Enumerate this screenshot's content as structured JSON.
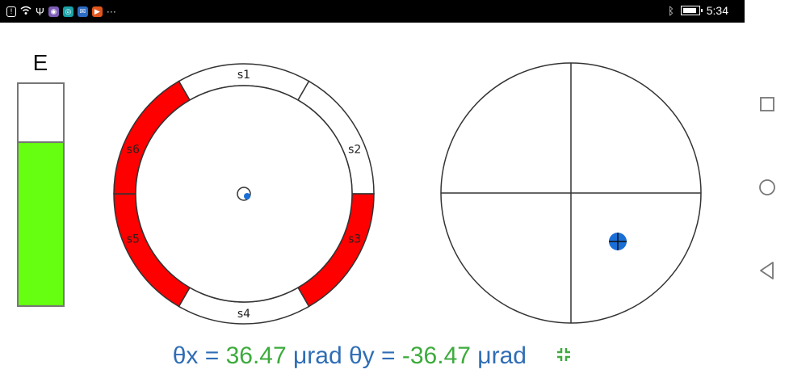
{
  "status_bar": {
    "time": "5:34",
    "notification_icons": [
      "alert-icon",
      "wifi-icon",
      "usb-icon",
      "viber-icon",
      "app-icon",
      "messenger-icon",
      "app-icon-2"
    ],
    "more": "···"
  },
  "energy": {
    "label": "E",
    "level": 0.74,
    "fill_color": "#66ff11"
  },
  "segment_ring": {
    "segments": [
      {
        "label": "s1",
        "active": false
      },
      {
        "label": "s2",
        "active": false
      },
      {
        "label": "s3",
        "active": true
      },
      {
        "label": "s4",
        "active": false
      },
      {
        "label": "s5",
        "active": true
      },
      {
        "label": "s6",
        "active": true
      }
    ],
    "active_color": "#ff0000"
  },
  "crosshair": {
    "point_color": "#1a6fd6"
  },
  "readout": {
    "theta_x_label": "θx = ",
    "theta_x_value": "36.47",
    "theta_x_unit": " μrad ",
    "theta_y_label": "θy = ",
    "theta_y_value": "-36.47",
    "theta_y_unit": " μrad"
  }
}
